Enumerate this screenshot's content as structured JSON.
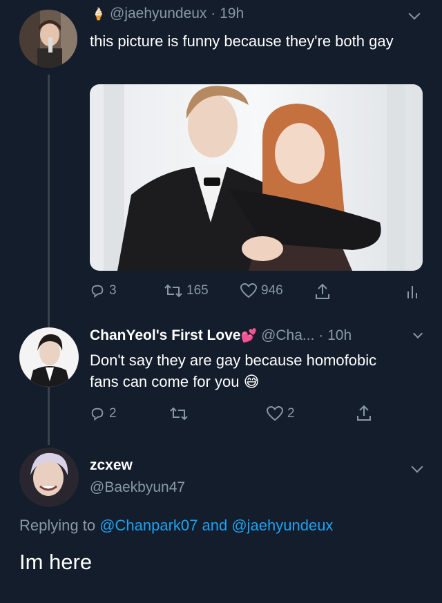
{
  "tweet1": {
    "handle": "@jaehyundeux",
    "sep": " · ",
    "time": "19h",
    "text": "this picture is funny because they're both gay",
    "replies": "3",
    "retweets": "165",
    "likes": "946",
    "emoji_badge": "🍦"
  },
  "tweet2": {
    "name": "ChanYeol's First Love",
    "emoji_badge": "💕",
    "handle": "@Cha...",
    "sep": " · ",
    "time": "10h",
    "text": "Don't say they are gay because homofobic fans can come for you",
    "emoji_end": "😅",
    "replies": "2",
    "retweets": "",
    "likes": "2"
  },
  "tweet3": {
    "name": "zcxew",
    "handle": "@Baekbyun47",
    "replying_prefix": "Replying to ",
    "reply_user1": "@Chanpark07",
    "reply_and": " and ",
    "reply_user2": "@jaehyundeux",
    "text": "Im here"
  },
  "colors": {
    "background": "#141d2b",
    "muted": "#8899a6",
    "link": "#1da1f2"
  },
  "icons": [
    "reply-icon",
    "retweet-icon",
    "like-icon",
    "share-icon",
    "analytics-icon",
    "chevron-down-icon"
  ]
}
